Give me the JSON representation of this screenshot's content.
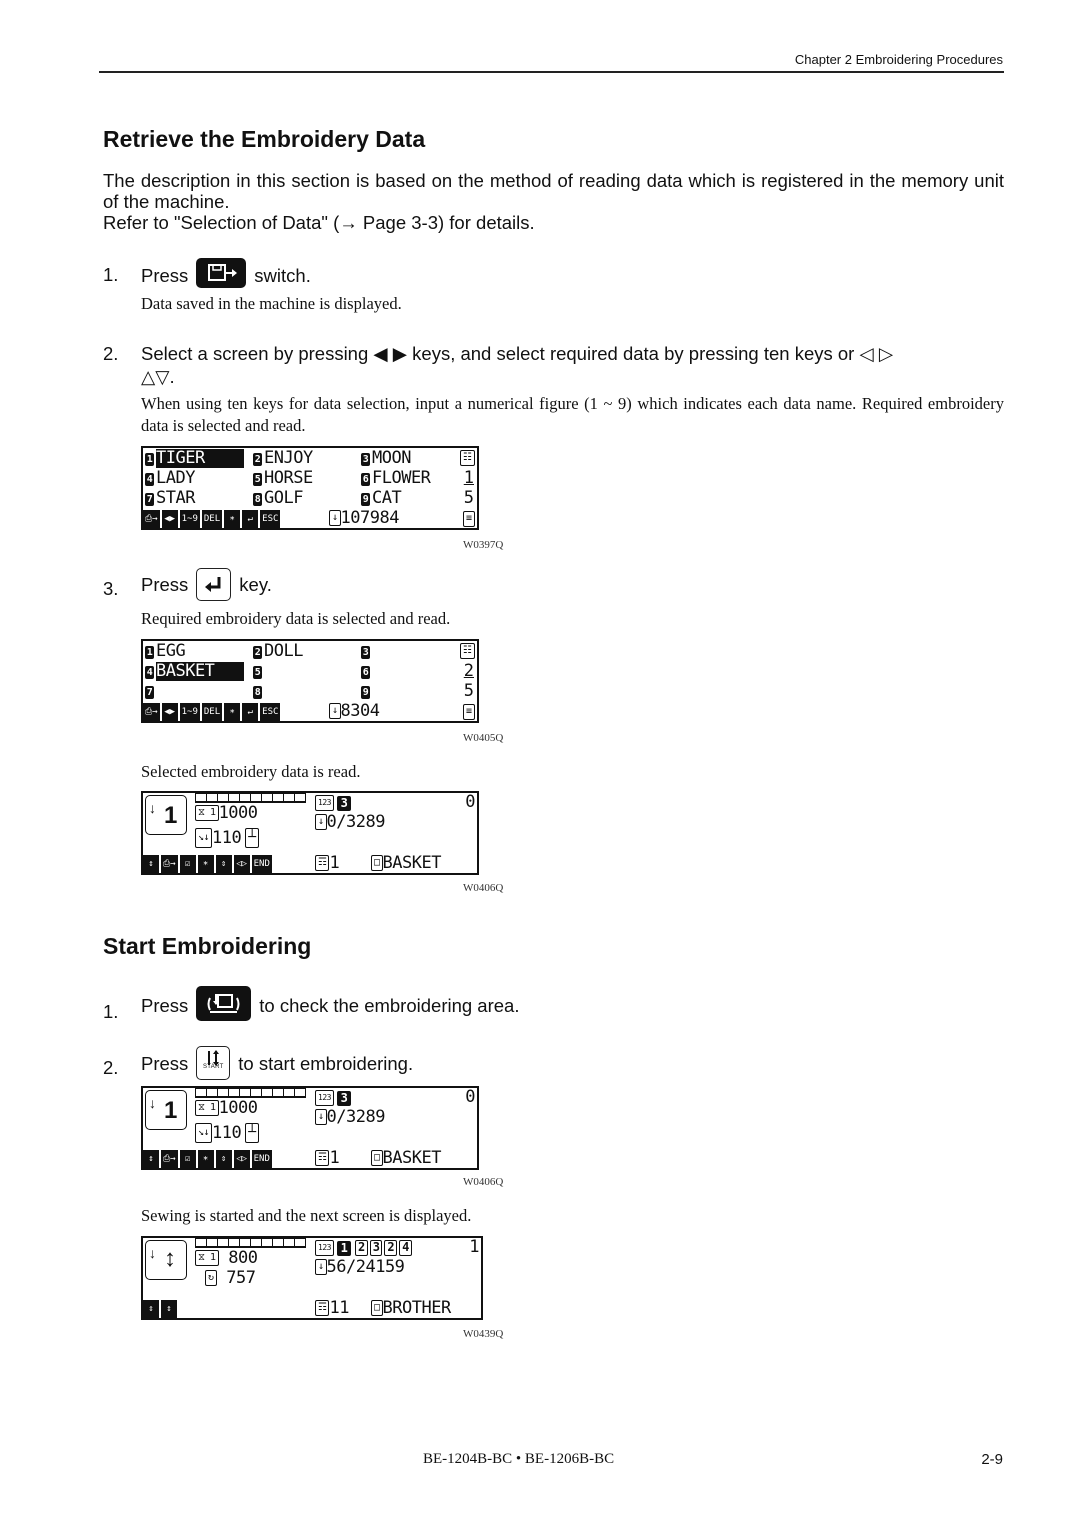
{
  "header": {
    "chapter": "Chapter 2 Embroidering Procedures"
  },
  "section1": {
    "title": "Retrieve the Embroidery Data",
    "intro_1": "The description in this section is based on the method of reading data which is registered in the memory unit of the machine.",
    "intro_2": "Refer to \"Selection of Data\" (→ Page 3-3) for details.",
    "steps": [
      {
        "num": "1.",
        "pre": "Press",
        "icon": "data-read-switch-icon",
        "post": "switch.",
        "note": "Data saved in the machine is displayed."
      },
      {
        "num": "2.",
        "text_a": "Select a screen by pressing",
        "arrows_solid": "◀ ▶",
        "text_b": "keys, and select required data by pressing ten keys or",
        "arrows_outline_lr": "◁ ▷",
        "arrows_outline_ud": "△▽.",
        "note": "When using ten keys for data selection, input a numerical figure (1 ~ 9) which indicates each data name. Required embroidery data is selected and read."
      },
      {
        "num": "3.",
        "pre": "Press",
        "icon": "enter-key-icon",
        "post": "key.",
        "note": "Required embroidery data is selected and read."
      }
    ],
    "after_note": "Selected embroidery data is read."
  },
  "section2": {
    "title": "Start Embroidering",
    "steps": [
      {
        "num": "1.",
        "pre": "Press",
        "icon": "frame-check-icon",
        "post": "to check the embroidering area."
      },
      {
        "num": "2.",
        "pre": "Press",
        "icon": "start-key-icon",
        "key_label": "START",
        "post": "to start embroidering."
      }
    ],
    "after_note": "Sewing is started and the next screen is displayed."
  },
  "screens": {
    "w0397": {
      "code": "W0397Q",
      "items": [
        {
          "n": "1",
          "name": "TIGER",
          "selected": true
        },
        {
          "n": "2",
          "name": "ENJOY"
        },
        {
          "n": "3",
          "name": "MOON"
        },
        {
          "n": "4",
          "name": "LADY"
        },
        {
          "n": "5",
          "name": "HORSE"
        },
        {
          "n": "6",
          "name": "FLOWER"
        },
        {
          "n": "7",
          "name": "STAR"
        },
        {
          "n": "8",
          "name": "GOLF"
        },
        {
          "n": "9",
          "name": "CAT"
        }
      ],
      "page": "1",
      "pages": "5",
      "stitches": "107984",
      "toolbar": [
        "⎙→",
        "◀▶",
        "1~9",
        "DEL",
        "∗",
        "↵",
        "ESC"
      ]
    },
    "w0405": {
      "code": "W0405Q",
      "items": [
        {
          "n": "1",
          "name": "EGG"
        },
        {
          "n": "2",
          "name": "DOLL"
        },
        {
          "n": "3",
          "name": ""
        },
        {
          "n": "4",
          "name": "BASKET",
          "selected": true
        },
        {
          "n": "5",
          "name": ""
        },
        {
          "n": "6",
          "name": ""
        },
        {
          "n": "7",
          "name": ""
        },
        {
          "n": "8",
          "name": ""
        },
        {
          "n": "9",
          "name": ""
        }
      ],
      "page": "2",
      "pages": "5",
      "stitches": "8304",
      "toolbar": [
        "⎙→",
        "◀▶",
        "1~9",
        "DEL",
        "∗",
        "↵",
        "ESC"
      ]
    },
    "w0406": {
      "code": "W0406Q",
      "needle": "1",
      "counter_label": "1",
      "counter": "1000",
      "speed": "110",
      "color_order": "3",
      "top_right": "0",
      "stitch_progress": "0/3289",
      "heads": "1",
      "data_name": "BASKET",
      "toolbar": [
        "↕",
        "⎙→",
        "☑",
        "∗",
        "⇕",
        "◁▷",
        "END"
      ]
    },
    "w0439": {
      "code": "W0439Q",
      "counter_label": "1",
      "counter": "800",
      "speed": "757",
      "color_sequence": [
        "1",
        "2",
        "3",
        "2",
        "4"
      ],
      "active_color": "1",
      "top_right": "1",
      "stitch_progress": "56/24159",
      "heads": "11",
      "data_name": "BROTHER",
      "toolbar": [
        "⇕",
        "↕"
      ]
    }
  },
  "footer": {
    "models": "BE-1204B-BC • BE-1206B-BC",
    "page": "2-9"
  }
}
